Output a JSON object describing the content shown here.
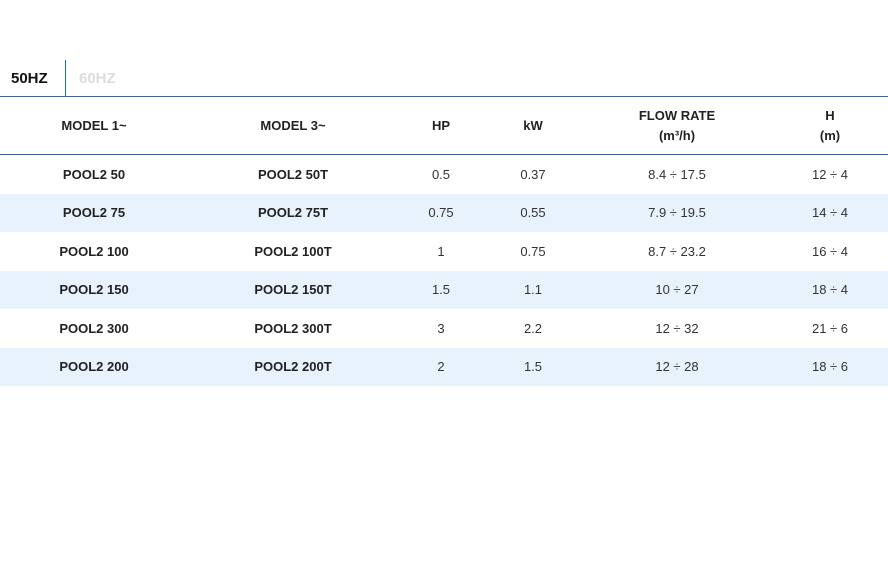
{
  "tabs": [
    {
      "label": "50HZ",
      "active": true
    },
    {
      "label": "60HZ",
      "active": false
    }
  ],
  "table": {
    "headers": {
      "model1": "MODEL 1~",
      "model3": "MODEL 3~",
      "hp": "HP",
      "kw": "kW",
      "flow_line1": "FLOW RATE",
      "flow_line2": "(m³/h)",
      "h_line1": "H",
      "h_line2": "(m)"
    },
    "rows": [
      {
        "model1": "POOL2 50",
        "model3": "POOL2 50T",
        "hp": "0.5",
        "kw": "0.37",
        "flow": "8.4 ÷ 17.5",
        "h": "12 ÷ 4"
      },
      {
        "model1": "POOL2 75",
        "model3": "POOL2 75T",
        "hp": "0.75",
        "kw": "0.55",
        "flow": "7.9 ÷ 19.5",
        "h": "14 ÷ 4"
      },
      {
        "model1": "POOL2 100",
        "model3": "POOL2 100T",
        "hp": "1",
        "kw": "0.75",
        "flow": "8.7 ÷ 23.2",
        "h": "16 ÷ 4"
      },
      {
        "model1": "POOL2 150",
        "model3": "POOL2 150T",
        "hp": "1.5",
        "kw": "1.1",
        "flow": "10 ÷ 27",
        "h": "18 ÷ 4"
      },
      {
        "model1": "POOL2 300",
        "model3": "POOL2 300T",
        "hp": "3",
        "kw": "2.2",
        "flow": "12 ÷ 32",
        "h": "21 ÷ 6"
      },
      {
        "model1": "POOL2 200",
        "model3": "POOL2 200T",
        "hp": "2",
        "kw": "1.5",
        "flow": "12 ÷ 28",
        "h": "18 ÷ 6"
      }
    ]
  },
  "colors": {
    "accent": "#1b6fc9",
    "stripe": "#e8f2fc",
    "inactive_tab": "#dcdcdc"
  }
}
